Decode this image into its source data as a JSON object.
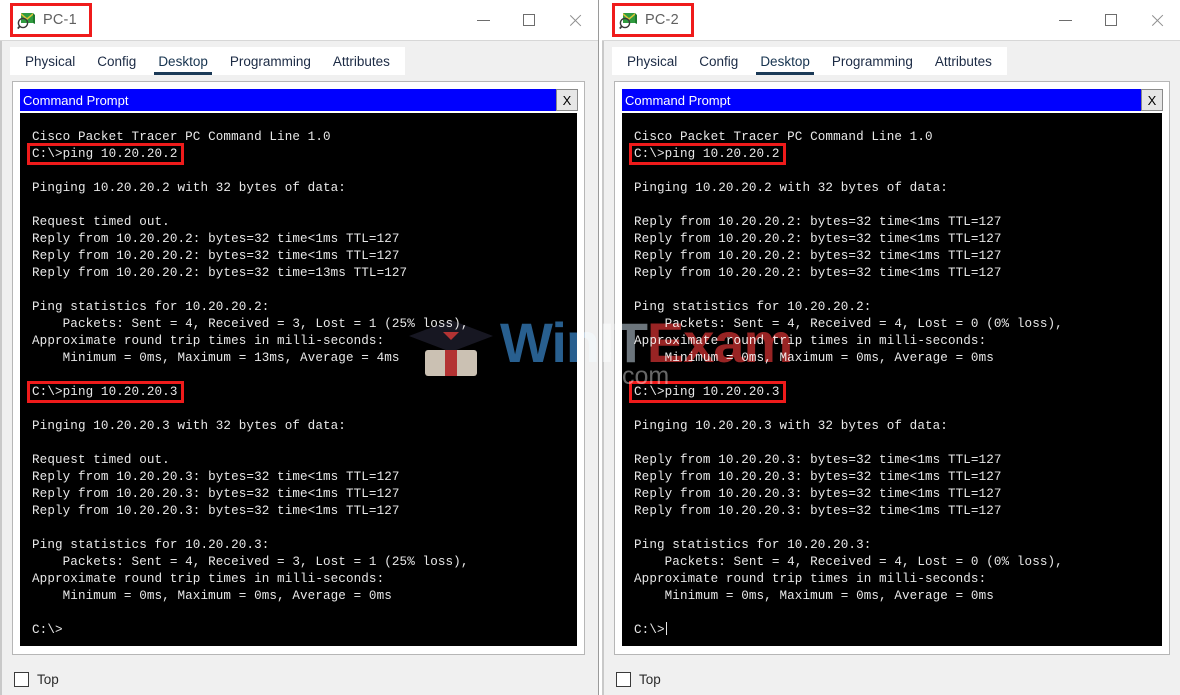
{
  "windows": [
    {
      "id": "pc1",
      "title": "PC-1",
      "icon": "packet-tracer-device-icon",
      "controls": {
        "minimize": "minimize-icon",
        "maximize": "maximize-icon",
        "close": "close-icon"
      },
      "tabs": [
        {
          "label": "Physical",
          "active": false
        },
        {
          "label": "Config",
          "active": false
        },
        {
          "label": "Desktop",
          "active": true
        },
        {
          "label": "Programming",
          "active": false
        },
        {
          "label": "Attributes",
          "active": false
        }
      ],
      "cmd": {
        "title": "Command Prompt",
        "close_label": "X",
        "lines": [
          "Cisco Packet Tracer PC Command Line 1.0",
          "C:\\>ping 10.20.20.2",
          "",
          "Pinging 10.20.20.2 with 32 bytes of data:",
          "",
          "Request timed out.",
          "Reply from 10.20.20.2: bytes=32 time<1ms TTL=127",
          "Reply from 10.20.20.2: bytes=32 time<1ms TTL=127",
          "Reply from 10.20.20.2: bytes=32 time=13ms TTL=127",
          "",
          "Ping statistics for 10.20.20.2:",
          "    Packets: Sent = 4, Received = 3, Lost = 1 (25% loss),",
          "Approximate round trip times in milli-seconds:",
          "    Minimum = 0ms, Maximum = 13ms, Average = 4ms",
          "",
          "C:\\>ping 10.20.20.3",
          "",
          "Pinging 10.20.20.3 with 32 bytes of data:",
          "",
          "Request timed out.",
          "Reply from 10.20.20.3: bytes=32 time<1ms TTL=127",
          "Reply from 10.20.20.3: bytes=32 time<1ms TTL=127",
          "Reply from 10.20.20.3: bytes=32 time<1ms TTL=127",
          "",
          "Ping statistics for 10.20.20.3:",
          "    Packets: Sent = 4, Received = 3, Lost = 1 (25% loss),",
          "Approximate round trip times in milli-seconds:",
          "    Minimum = 0ms, Maximum = 0ms, Average = 0ms",
          "",
          "C:\\>"
        ],
        "highlighted_lines": [
          1,
          15
        ],
        "cursor_on_last_line": false
      },
      "bottom": {
        "checkbox_label": "Top",
        "checked": false
      }
    },
    {
      "id": "pc2",
      "title": "PC-2",
      "icon": "packet-tracer-device-icon",
      "controls": {
        "minimize": "minimize-icon",
        "maximize": "maximize-icon",
        "close": "close-icon"
      },
      "tabs": [
        {
          "label": "Physical",
          "active": false
        },
        {
          "label": "Config",
          "active": false
        },
        {
          "label": "Desktop",
          "active": true
        },
        {
          "label": "Programming",
          "active": false
        },
        {
          "label": "Attributes",
          "active": false
        }
      ],
      "cmd": {
        "title": "Command Prompt",
        "close_label": "X",
        "lines": [
          "Cisco Packet Tracer PC Command Line 1.0",
          "C:\\>ping 10.20.20.2",
          "",
          "Pinging 10.20.20.2 with 32 bytes of data:",
          "",
          "Reply from 10.20.20.2: bytes=32 time<1ms TTL=127",
          "Reply from 10.20.20.2: bytes=32 time<1ms TTL=127",
          "Reply from 10.20.20.2: bytes=32 time<1ms TTL=127",
          "Reply from 10.20.20.2: bytes=32 time<1ms TTL=127",
          "",
          "Ping statistics for 10.20.20.2:",
          "    Packets: Sent = 4, Received = 4, Lost = 0 (0% loss),",
          "Approximate round trip times in milli-seconds:",
          "    Minimum = 0ms, Maximum = 0ms, Average = 0ms",
          "",
          "C:\\>ping 10.20.20.3",
          "",
          "Pinging 10.20.20.3 with 32 bytes of data:",
          "",
          "Reply from 10.20.20.3: bytes=32 time<1ms TTL=127",
          "Reply from 10.20.20.3: bytes=32 time<1ms TTL=127",
          "Reply from 10.20.20.3: bytes=32 time<1ms TTL=127",
          "Reply from 10.20.20.3: bytes=32 time<1ms TTL=127",
          "",
          "Ping statistics for 10.20.20.3:",
          "    Packets: Sent = 4, Received = 4, Lost = 0 (0% loss),",
          "Approximate round trip times in milli-seconds:",
          "    Minimum = 0ms, Maximum = 0ms, Average = 0ms",
          "",
          "C:\\>"
        ],
        "highlighted_lines": [
          1,
          15
        ],
        "cursor_on_last_line": true
      },
      "bottom": {
        "checkbox_label": "Top",
        "checked": false
      }
    }
  ],
  "watermark": {
    "part1": "Win",
    "part2": "IT",
    "part3": "Exam",
    "suffix": ".com",
    "logo": "graduation-cap-icon"
  },
  "colors": {
    "annotation_red": "#ef1b1b",
    "cmd_title_blue": "#0000ff",
    "tab_active_underline": "#1b3a57",
    "terminal_bg": "#000000",
    "terminal_text": "#e8e8e8",
    "window_chrome": "#f0f0f0"
  }
}
